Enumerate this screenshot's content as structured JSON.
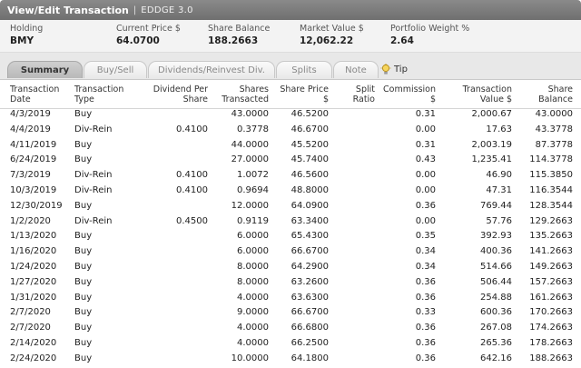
{
  "title": "View/Edit Transaction",
  "app": "EDDGE 3.0",
  "summary": [
    {
      "label": "Holding",
      "value": "BMY"
    },
    {
      "label": "Current Price $",
      "value": "64.0700"
    },
    {
      "label": "Share Balance",
      "value": "188.2663"
    },
    {
      "label": "Market Value $",
      "value": "12,062.22"
    },
    {
      "label": "Portfolio Weight %",
      "value": "2.64"
    }
  ],
  "tabs": [
    {
      "label": "Summary",
      "active": true
    },
    {
      "label": "Buy/Sell",
      "active": false
    },
    {
      "label": "Dividends/Reinvest Div.",
      "active": false
    },
    {
      "label": "Splits",
      "active": false
    },
    {
      "label": "Note",
      "active": false
    }
  ],
  "tip_label": "Tip",
  "columns": [
    [
      "Transaction",
      "Date"
    ],
    [
      "Transaction",
      "Type"
    ],
    [
      "Dividend Per",
      "Share"
    ],
    [
      "Shares",
      "Transacted"
    ],
    [
      "Share Price",
      "$"
    ],
    [
      "Split",
      "Ratio"
    ],
    [
      "Commission",
      "$"
    ],
    [
      "Transaction",
      "Value $"
    ],
    [
      "Share",
      "Balance"
    ]
  ],
  "rows": [
    [
      "4/3/2019",
      "Buy",
      "",
      "43.0000",
      "46.5200",
      "",
      "0.31",
      "2,000.67",
      "43.0000"
    ],
    [
      "4/4/2019",
      "Div-Rein",
      "0.4100",
      "0.3778",
      "46.6700",
      "",
      "0.00",
      "17.63",
      "43.3778"
    ],
    [
      "4/11/2019",
      "Buy",
      "",
      "44.0000",
      "45.5200",
      "",
      "0.31",
      "2,003.19",
      "87.3778"
    ],
    [
      "6/24/2019",
      "Buy",
      "",
      "27.0000",
      "45.7400",
      "",
      "0.43",
      "1,235.41",
      "114.3778"
    ],
    [
      "7/3/2019",
      "Div-Rein",
      "0.4100",
      "1.0072",
      "46.5600",
      "",
      "0.00",
      "46.90",
      "115.3850"
    ],
    [
      "10/3/2019",
      "Div-Rein",
      "0.4100",
      "0.9694",
      "48.8000",
      "",
      "0.00",
      "47.31",
      "116.3544"
    ],
    [
      "12/30/2019",
      "Buy",
      "",
      "12.0000",
      "64.0900",
      "",
      "0.36",
      "769.44",
      "128.3544"
    ],
    [
      "1/2/2020",
      "Div-Rein",
      "0.4500",
      "0.9119",
      "63.3400",
      "",
      "0.00",
      "57.76",
      "129.2663"
    ],
    [
      "1/13/2020",
      "Buy",
      "",
      "6.0000",
      "65.4300",
      "",
      "0.35",
      "392.93",
      "135.2663"
    ],
    [
      "1/16/2020",
      "Buy",
      "",
      "6.0000",
      "66.6700",
      "",
      "0.34",
      "400.36",
      "141.2663"
    ],
    [
      "1/24/2020",
      "Buy",
      "",
      "8.0000",
      "64.2900",
      "",
      "0.34",
      "514.66",
      "149.2663"
    ],
    [
      "1/27/2020",
      "Buy",
      "",
      "8.0000",
      "63.2600",
      "",
      "0.36",
      "506.44",
      "157.2663"
    ],
    [
      "1/31/2020",
      "Buy",
      "",
      "4.0000",
      "63.6300",
      "",
      "0.36",
      "254.88",
      "161.2663"
    ],
    [
      "2/7/2020",
      "Buy",
      "",
      "9.0000",
      "66.6700",
      "",
      "0.33",
      "600.36",
      "170.2663"
    ],
    [
      "2/7/2020",
      "Buy",
      "",
      "4.0000",
      "66.6800",
      "",
      "0.36",
      "267.08",
      "174.2663"
    ],
    [
      "2/14/2020",
      "Buy",
      "",
      "4.0000",
      "66.2500",
      "",
      "0.36",
      "265.36",
      "178.2663"
    ],
    [
      "2/24/2020",
      "Buy",
      "",
      "10.0000",
      "64.1800",
      "",
      "0.36",
      "642.16",
      "188.2663"
    ]
  ]
}
